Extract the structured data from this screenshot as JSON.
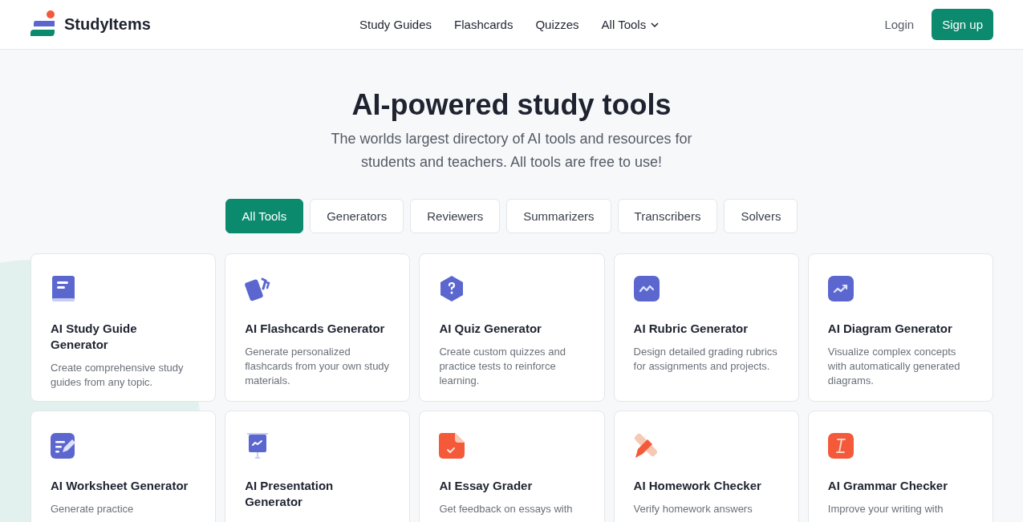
{
  "header": {
    "brand": "StudyItems",
    "nav": [
      {
        "label": "Study Guides"
      },
      {
        "label": "Flashcards"
      },
      {
        "label": "Quizzes"
      },
      {
        "label": "All Tools",
        "dropdown": true
      }
    ],
    "login": "Login",
    "signup": "Sign up"
  },
  "hero": {
    "title": "AI-powered study tools",
    "subtitle": "The worlds largest directory of AI tools and resources for students and teachers. All tools are free to use!"
  },
  "filters": [
    {
      "label": "All Tools",
      "selected": true
    },
    {
      "label": "Generators",
      "selected": false
    },
    {
      "label": "Reviewers",
      "selected": false
    },
    {
      "label": "Summarizers",
      "selected": false
    },
    {
      "label": "Transcribers",
      "selected": false
    },
    {
      "label": "Solvers",
      "selected": false
    }
  ],
  "tools": [
    {
      "kind": "book",
      "color": "#5b67cf",
      "title": "AI Study Guide Generator",
      "description": "Create comprehensive study guides from any topic."
    },
    {
      "kind": "cards",
      "color": "#5b67cf",
      "title": "AI Flashcards Generator",
      "description": "Generate personalized flashcards from your own study materials."
    },
    {
      "kind": "hexagon",
      "color": "#5b67cf",
      "title": "AI Quiz Generator",
      "description": "Create custom quizzes and practice tests to reinforce learning."
    },
    {
      "kind": "wave",
      "color": "#5b67cf",
      "title": "AI Rubric Generator",
      "description": "Design detailed grading rubrics for assignments and projects."
    },
    {
      "kind": "trend",
      "color": "#5b67cf",
      "title": "AI Diagram Generator",
      "description": "Visualize complex concepts with automatically generated diagrams."
    },
    {
      "kind": "worksheet",
      "color": "#5b67cf",
      "title": "AI Worksheet Generator",
      "description": "Generate practice"
    },
    {
      "kind": "presentation",
      "color": "#5b67cf",
      "title": "AI Presentation Generator"
    },
    {
      "kind": "essay",
      "color": "#f4593a",
      "title": "AI Essay Grader",
      "description": "Get feedback on essays with"
    },
    {
      "kind": "pencil",
      "color": "#f4593a",
      "title": "AI Homework Checker",
      "description": "Verify homework answers"
    },
    {
      "kind": "cursor",
      "color": "#f4593a",
      "title": "AI Grammar Checker",
      "description": "Improve your writing with"
    }
  ]
}
